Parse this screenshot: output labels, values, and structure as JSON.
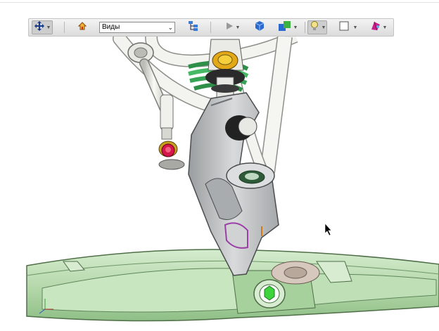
{
  "toolbar": {
    "views_label": "Виды"
  },
  "colors": {
    "arm_green": "#b9dcb0",
    "spring_green": "#3cae5a",
    "bolt_green": "#5ad65a",
    "rod_red": "#d0164a",
    "cap_yellow": "#f0c020",
    "upright_gray": "#bfc2c4",
    "rod_white": "#f2f2ee"
  },
  "icons": [
    "pan-icon",
    "home-icon",
    "model-tree-icon",
    "play-icon",
    "cube-view-icon",
    "shaded-cubes-icon",
    "light-bulb-icon",
    "square-outline-icon",
    "color-palette-icon",
    "mouse-cursor-icon"
  ]
}
